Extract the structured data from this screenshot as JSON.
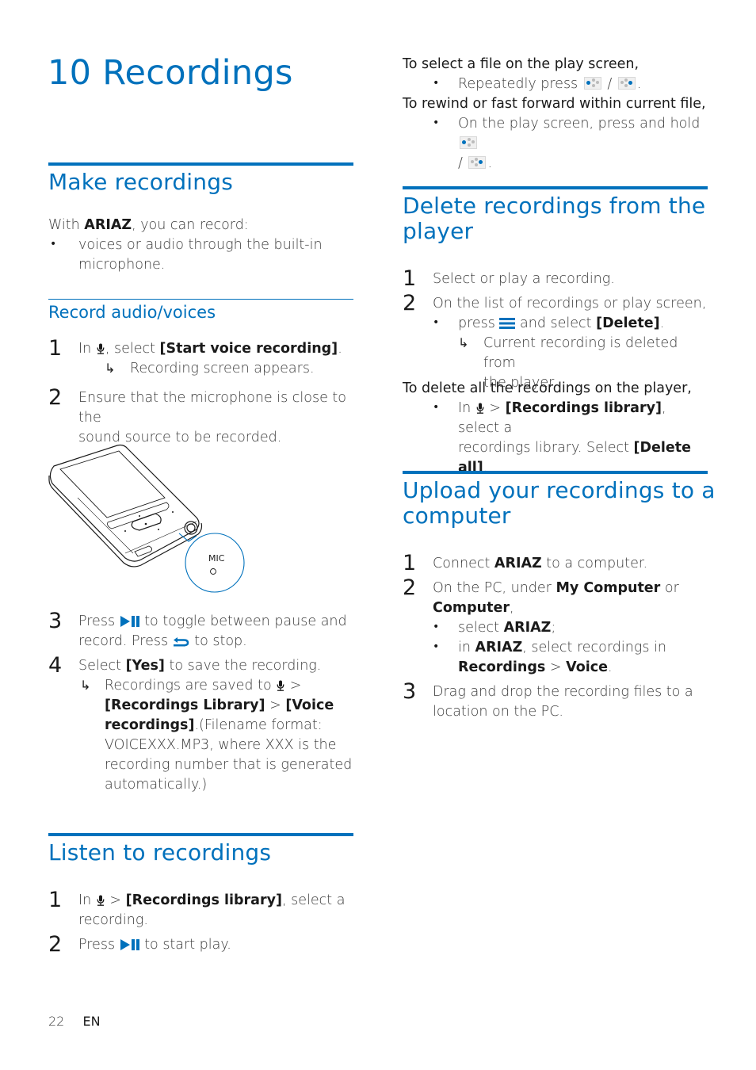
{
  "chapter": {
    "title": "10 Recordings"
  },
  "make": {
    "heading": "Make recordings",
    "intro_pre": "With ",
    "intro_bold": "ARIAZ",
    "intro_post": ", you can record:",
    "bullet_line1": "voices or audio through the built-in",
    "bullet_line2": "microphone."
  },
  "record": {
    "heading": "Record audio/voices",
    "step1": {
      "num": "1",
      "pre": "In ",
      "mid": ", select ",
      "bold": "[Start voice recording]",
      "post": ".",
      "result": "Recording screen appears."
    },
    "step2": {
      "num": "2",
      "line1": "Ensure that the microphone is close to the",
      "line2": "sound source to be recorded."
    },
    "illustration": {
      "callout_label": "MIC"
    },
    "step3": {
      "num": "3",
      "l1_pre": "Press ",
      "l1_post": " to toggle between pause and",
      "l2_pre": "record. Press ",
      "l2_post": " to stop."
    },
    "step4": {
      "num": "4",
      "pre": "Select ",
      "bold": "[Yes]",
      "post": " to save the recording.",
      "result_l1_pre": "Recordings are saved to ",
      "result_l1_post": " >",
      "result_l2_b1": "[Recordings Library]",
      "result_l2_mid": " > ",
      "result_l2_b2": "[Voice",
      "result_l3_b": "recordings]",
      "result_l3_post": ".(Filename format:",
      "result_l4": "VOICEXXX.MP3, where XXX is the",
      "result_l5": "recording number that is generated",
      "result_l6": "automatically.)"
    }
  },
  "listen": {
    "heading": "Listen to recordings",
    "step1": {
      "num": "1",
      "pre": "In ",
      "mid": " > ",
      "bold": "[Recordings library]",
      "post": ", select a",
      "line2": "recording."
    },
    "step2": {
      "num": "2",
      "pre": "Press ",
      "post": " to start play."
    }
  },
  "select_file": {
    "lead": "To select a file on the play screen,",
    "bullet_pre": "Repeatedly press ",
    "sep": " / ",
    "post": "."
  },
  "rewind": {
    "lead": "To rewind or fast forward within current file,",
    "bullet_pre": "On the play screen, press and hold ",
    "sep": "/ ",
    "post": "."
  },
  "delete": {
    "heading_l1": "Delete recordings from the",
    "heading_l2": "player",
    "step1": {
      "num": "1",
      "text": "Select or play a recording."
    },
    "step2": {
      "num": "2",
      "text": "On the list of recordings or play screen,",
      "bullet_pre": "press ",
      "bullet_mid": " and select ",
      "bullet_bold": "[Delete]",
      "bullet_post": ".",
      "result_l1": "Current recording is deleted from",
      "result_l2": "the player."
    },
    "all_lead": "To delete all the recordings on the player,",
    "all_pre": "In ",
    "all_mid": " > ",
    "all_bold1": "[Recordings library]",
    "all_post1": ", select a",
    "all_l2_pre": "recordings library. Select ",
    "all_bold2": "[Delete all]",
    "all_l2_post": "."
  },
  "upload": {
    "heading_l1": "Upload your recordings to a",
    "heading_l2": "computer",
    "step1": {
      "num": "1",
      "pre": "Connect ",
      "bold": "ARIAZ",
      "post": " to a computer."
    },
    "step2": {
      "num": "2",
      "pre": "On the PC, under ",
      "bold1": "My Computer",
      "mid": " or",
      "bold2": "Computer",
      "post": ",",
      "b1_pre": "select ",
      "b1_bold": "ARIAZ",
      "b1_post": ";",
      "b2_pre": "in ",
      "b2_bold": "ARIAZ",
      "b2_post": ", select recordings in",
      "b2_l2_b1": "Recordings",
      "b2_l2_mid": " > ",
      "b2_l2_b2": "Voice",
      "b2_l2_post": "."
    },
    "step3": {
      "num": "3",
      "line1": "Drag and drop the recording files to a",
      "line2": "location on the PC."
    }
  },
  "footer": {
    "page": "22",
    "lang": "EN"
  },
  "colors": {
    "accent": "#0071bc",
    "text": "#3a3a3a"
  }
}
